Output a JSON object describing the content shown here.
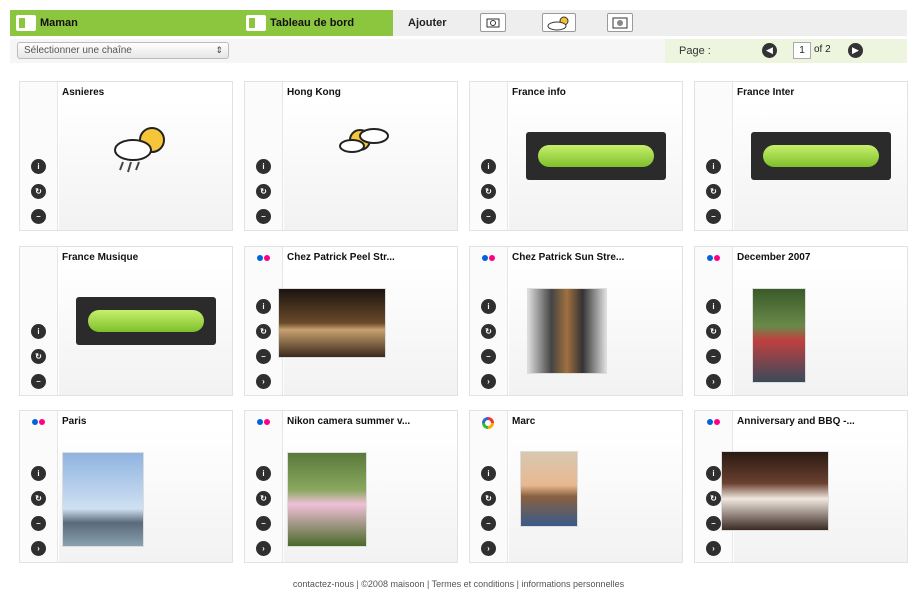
{
  "topbar": {
    "user_tab": "Maman",
    "dashboard_tab": "Tableau de bord",
    "add_label": "Ajouter",
    "add_icons": [
      "webcam-icon",
      "weather-icon",
      "radio-icon"
    ]
  },
  "subbar": {
    "channel_select": "Sélectionner une chaîne",
    "page_label": "Page :",
    "page_current": "1",
    "page_total": "of 2"
  },
  "cards": [
    {
      "title": "Asnieres",
      "type": "weather",
      "icon": "rain-sun-icon"
    },
    {
      "title": "Hong Kong",
      "type": "weather",
      "icon": "cloud-sun-icon"
    },
    {
      "title": "France info",
      "type": "radio"
    },
    {
      "title": "France Inter",
      "type": "radio"
    },
    {
      "title": "France Musique",
      "type": "radio"
    },
    {
      "title": "Chez Patrick Peel Str...",
      "type": "photo",
      "source": "flickr"
    },
    {
      "title": "Chez Patrick Sun Stre...",
      "type": "photo",
      "source": "flickr"
    },
    {
      "title": "December 2007",
      "type": "photo",
      "source": "flickr"
    },
    {
      "title": "Paris",
      "type": "photo",
      "source": "flickr"
    },
    {
      "title": "Nikon camera summer v...",
      "type": "photo",
      "source": "flickr"
    },
    {
      "title": "Marc",
      "type": "photo",
      "source": "picasa"
    },
    {
      "title": "Anniversary and BBQ -...",
      "type": "photo",
      "source": "flickr"
    }
  ],
  "footer": "contactez-nous | ©2008 maisoon | Termes et conditions | informations personnelles",
  "colors": {
    "accent": "#8cc63f",
    "flickr_pink": "#ff0084",
    "flickr_blue": "#0063dc"
  }
}
